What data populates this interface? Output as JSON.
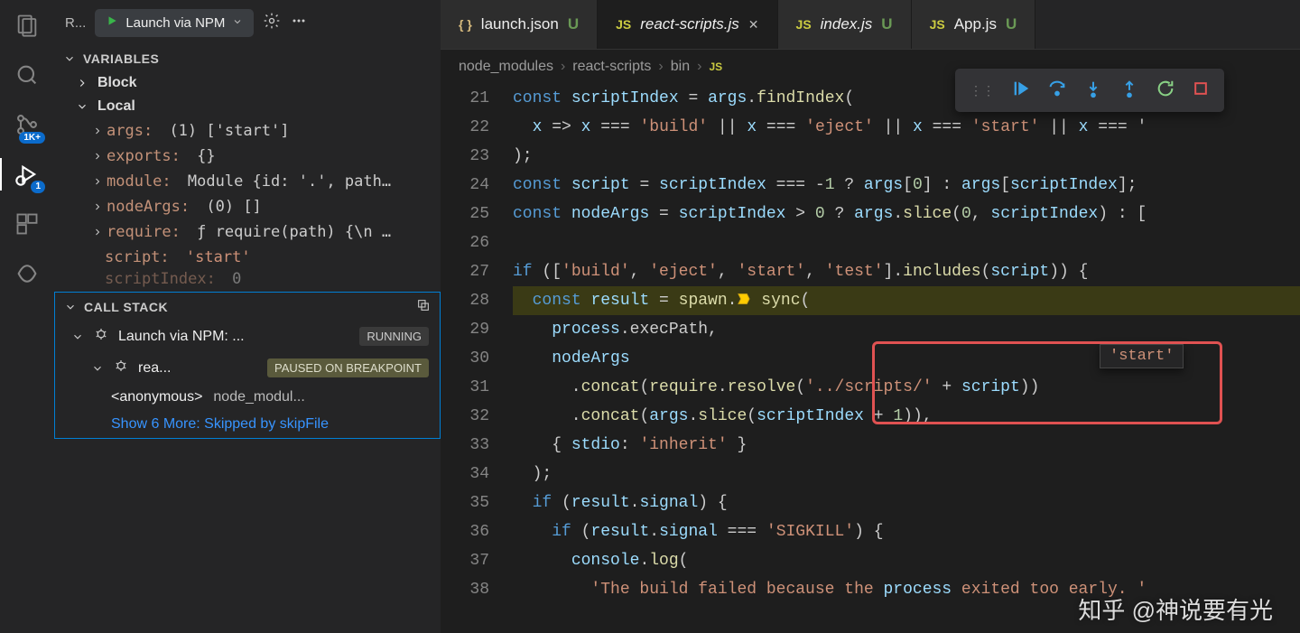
{
  "activity": {
    "badges": {
      "scm": "1K+",
      "debug": "1"
    }
  },
  "debug_panel": {
    "config_label": "R...",
    "launch_name": "Launch via NPM"
  },
  "sections": {
    "variables": "VARIABLES",
    "callstack": "CALL STACK"
  },
  "scopes": {
    "block": "Block",
    "local": "Local"
  },
  "vars": {
    "args": {
      "name": "args:",
      "value": "(1) ['start']"
    },
    "exports": {
      "name": "exports:",
      "value": "{}"
    },
    "module": {
      "name": "module:",
      "value": "Module {id: '.', path…"
    },
    "nodeArgs": {
      "name": "nodeArgs:",
      "value": "(0) []"
    },
    "require": {
      "name": "require:",
      "value": "ƒ require(path) {\\n …"
    },
    "script": {
      "name": "script:",
      "value": "'start'"
    },
    "scriptIndex": {
      "name": "scriptIndex:",
      "value": "0"
    }
  },
  "callstack": {
    "root": {
      "label": "Launch via NPM: ...",
      "status": "RUNNING"
    },
    "child": {
      "label": "rea...",
      "status": "PAUSED ON BREAKPOINT"
    },
    "frame": {
      "fn": "<anonymous>",
      "loc": "node_modul..."
    },
    "showmore": "Show 6 More: Skipped by skipFile"
  },
  "tabs": [
    {
      "icon": "braces",
      "title": "launch.json",
      "italic": false,
      "modified": true,
      "closable": false
    },
    {
      "icon": "js",
      "title": "react-scripts.js",
      "italic": true,
      "modified": false,
      "closable": true,
      "active": true
    },
    {
      "icon": "js",
      "title": "index.js",
      "italic": true,
      "modified": true,
      "closable": false
    },
    {
      "icon": "js",
      "title": "App.js",
      "italic": false,
      "modified": true,
      "closable": false
    }
  ],
  "breadcrumb": [
    "node_modules",
    "react-scripts",
    "bin"
  ],
  "bc_file_icon": "JS",
  "code": {
    "start": 21,
    "current": 28,
    "lines": [
      "const scriptIndex = args.findIndex(",
      "  x => x === 'build' || x === 'eject' || x === 'start' || x === '",
      ");",
      "const script = scriptIndex === -1 ? args[0] : args[scriptIndex];",
      "const nodeArgs = scriptIndex > 0 ? args.slice(0, scriptIndex) : [",
      "",
      "if (['build', 'eject', 'start', 'test'].includes(script)) {",
      "  const result = spawn.sync(",
      "    process.execPath,",
      "    nodeArgs",
      "      .concat(require.resolve('../scripts/' + script))",
      "      .concat(args.slice(scriptIndex + 1)),",
      "    { stdio: 'inherit' }",
      "  );",
      "  if (result.signal) {",
      "    if (result.signal === 'SIGKILL') {",
      "      console.log(",
      "        'The build failed because the process exited too early. '"
    ]
  },
  "hover_value": "'start'",
  "watermark": "知乎 @神说要有光"
}
